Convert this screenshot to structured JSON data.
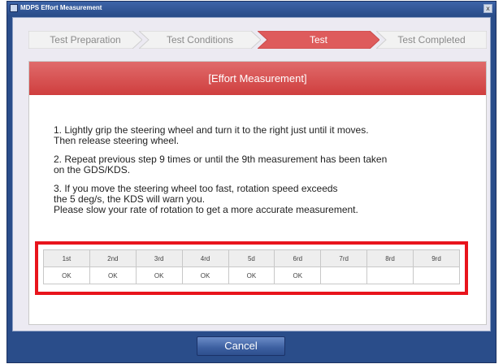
{
  "window": {
    "title": "MDPS Effort Measurement",
    "close_glyph": "x"
  },
  "steps": [
    {
      "label": "Test Preparation",
      "state": "done"
    },
    {
      "label": "Test Conditions",
      "state": "done"
    },
    {
      "label": "Test",
      "state": "active"
    },
    {
      "label": "Test Completed",
      "state": "pending"
    }
  ],
  "panel": {
    "header": "[Effort Measurement]",
    "instructions": [
      "1. Lightly grip the steering wheel and turn it to the right just until it moves.\n      Then release steering wheel.",
      "2. Repeat previous step 9 times or until the 9th measurement has been taken\n    on the GDS/KDS.",
      "3. If you move the steering wheel too fast, rotation speed exceeds\n    the 5 deg/s, the KDS will warn you.\n    Please slow your rate of rotation to get a more  accurate measurement."
    ]
  },
  "results": {
    "headers": [
      "1st",
      "2nd",
      "3rd",
      "4rd",
      "5d",
      "6rd",
      "7rd",
      "8rd",
      "9rd"
    ],
    "values": [
      "OK",
      "OK",
      "OK",
      "OK",
      "OK",
      "OK",
      "",
      "",
      ""
    ]
  },
  "footer": {
    "cancel_label": "Cancel"
  },
  "colors": {
    "accent_red": "#d9474a",
    "highlight_red": "#e8141c",
    "window_blue": "#2a4d8a"
  }
}
